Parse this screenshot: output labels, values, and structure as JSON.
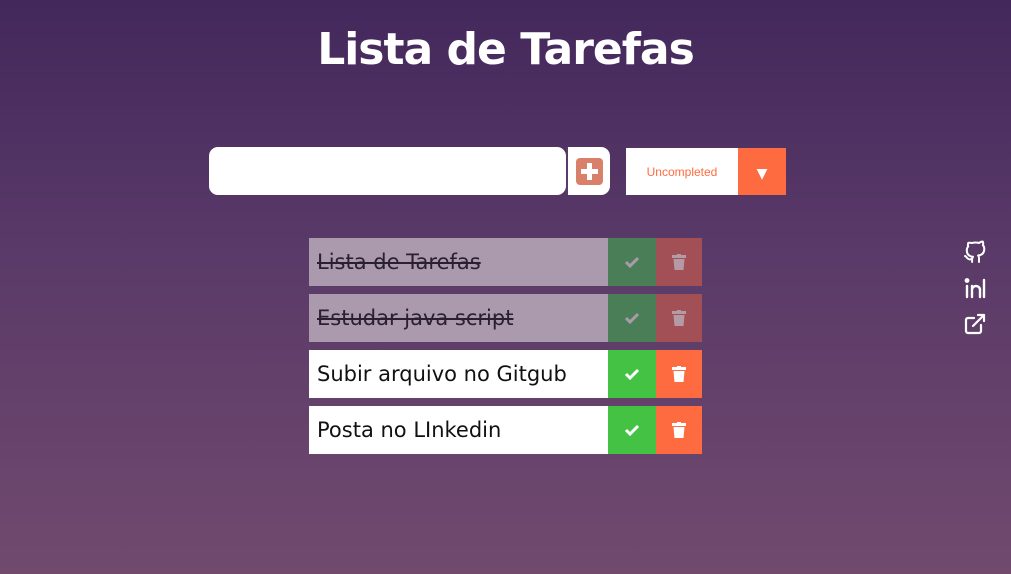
{
  "page": {
    "title": "Lista de Tarefas"
  },
  "input": {
    "value": "",
    "placeholder": ""
  },
  "filter": {
    "selected": "Uncompleted",
    "arrow": "▼"
  },
  "todos": [
    {
      "text": "Lista de Tarefas",
      "completed": true
    },
    {
      "text": "Estudar java  script",
      "completed": true
    },
    {
      "text": "Subir arquivo no Gitgub",
      "completed": false
    },
    {
      "text": "Posta no LInkedin",
      "completed": false
    }
  ],
  "social": [
    "github-icon",
    "linkedin-icon",
    "external-link-icon"
  ],
  "colors": {
    "accent": "#ff6b40",
    "check": "#44c244",
    "add_button": "#d8806a",
    "background_top": "#43285c",
    "background_bottom": "#714a6e"
  }
}
